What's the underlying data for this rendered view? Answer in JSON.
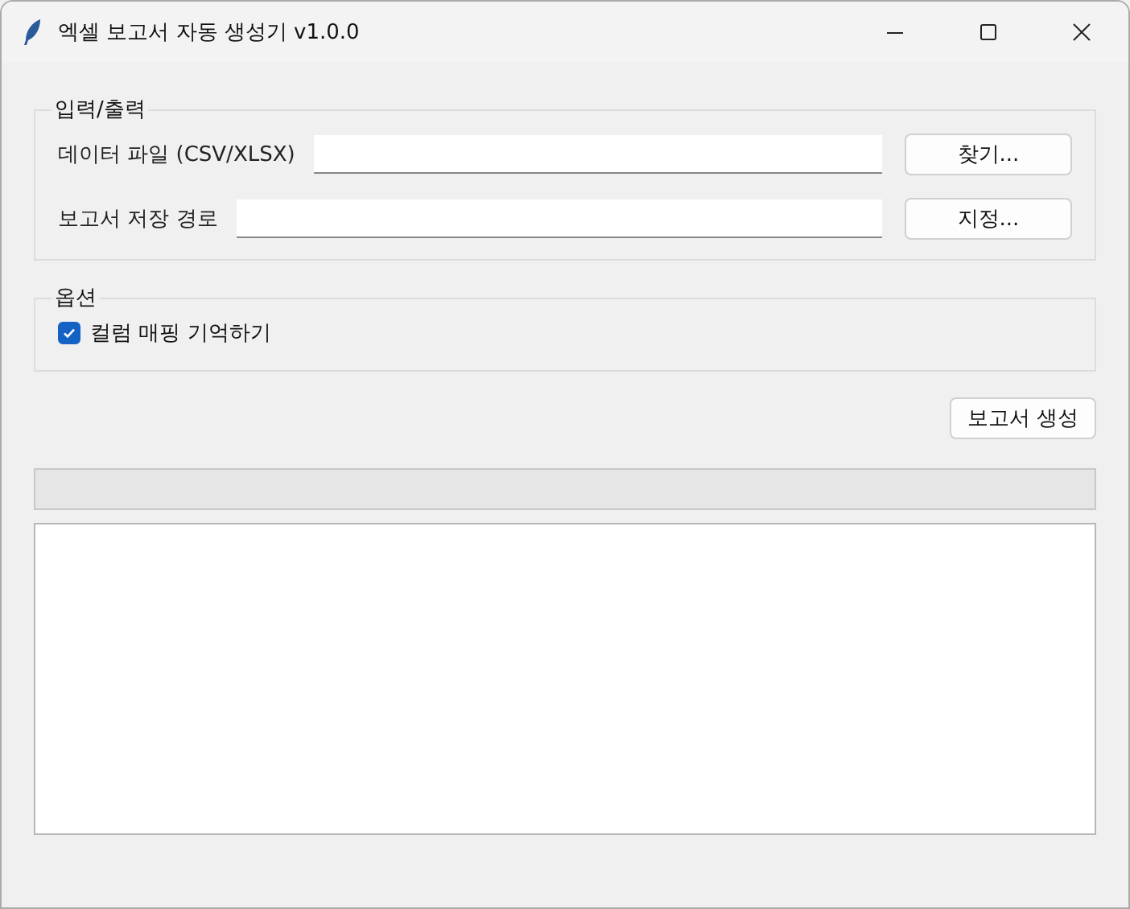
{
  "window": {
    "title": "엑셀 보고서 자동 생성기 v1.0.0"
  },
  "io_group": {
    "title": "입력/출력",
    "rows": [
      {
        "label": "데이터 파일 (CSV/XLSX)",
        "button": "찾기..."
      },
      {
        "label": "보고서 저장 경로",
        "button": "지정..."
      }
    ]
  },
  "options_group": {
    "title": "옵션",
    "checkbox": {
      "label": "컬럼 매핑 기억하기",
      "checked": true
    }
  },
  "generate_button": "보고서 생성"
}
